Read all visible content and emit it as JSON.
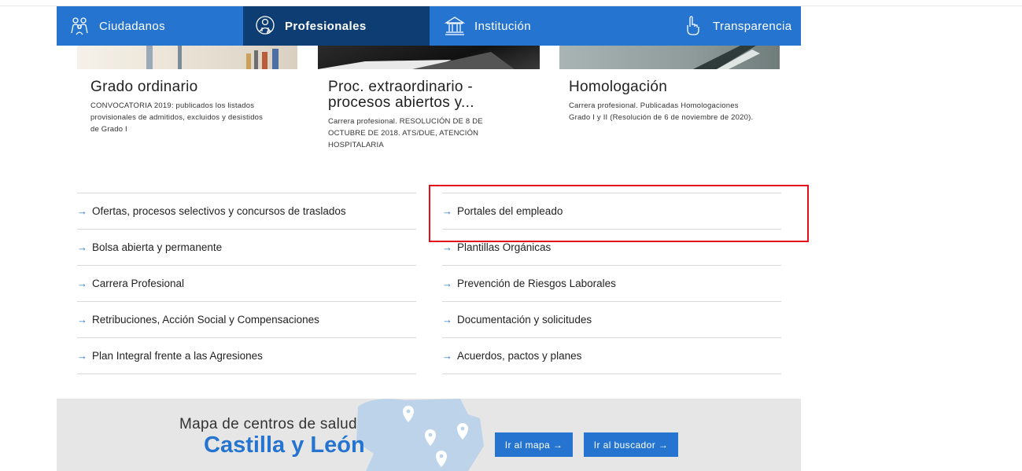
{
  "nav": {
    "items": [
      {
        "label": "Ciudadanos",
        "icon": "people-icon"
      },
      {
        "label": "Profesionales",
        "icon": "doctor-icon"
      },
      {
        "label": "Institución",
        "icon": "building-icon"
      },
      {
        "label": "Transparencia",
        "icon": "hand-icon"
      }
    ],
    "active_color": "#0e3d73",
    "bar_color": "#2575d0"
  },
  "cards": [
    {
      "title_lines": [
        "Grado ordinario"
      ],
      "desc_lines": [
        "CONVOCATORIA 2019: publicados los listados",
        "provisionales de admitidos, excluidos y desistidos",
        "de Grado I"
      ]
    },
    {
      "title_lines": [
        "Proc. extraordinario -",
        "procesos abiertos y..."
      ],
      "desc_lines": [
        "Carrera profesional. RESOLUCIÓN DE 8 DE",
        "OCTUBRE DE 2018. ATS/DUE, ATENCIÓN",
        "HOSPITALARIA"
      ]
    },
    {
      "title_lines": [
        "Homologación"
      ],
      "desc_lines": [
        "Carrera profesional. Publicadas Homologaciones",
        "Grado I y II (Resolución de 6 de noviembre de 2020)."
      ]
    }
  ],
  "links_left": [
    "Ofertas, procesos selectivos y concursos de traslados",
    "Bolsa abierta y permanente",
    "Carrera Profesional",
    "Retribuciones, Acción Social y Compensaciones",
    "Plan Integral frente a las Agresiones"
  ],
  "links_right": [
    "Portales del empleado",
    "Plantillas Orgánicas",
    "Prevención de Riesgos Laborales",
    "Documentación y solicitudes",
    "Acuerdos, pactos y planes"
  ],
  "arrow": "→",
  "banner": {
    "subtitle": "Mapa de centros de salud",
    "title": "Castilla y León",
    "btn_map": "Ir al mapa →",
    "btn_search": "Ir al buscador →"
  }
}
